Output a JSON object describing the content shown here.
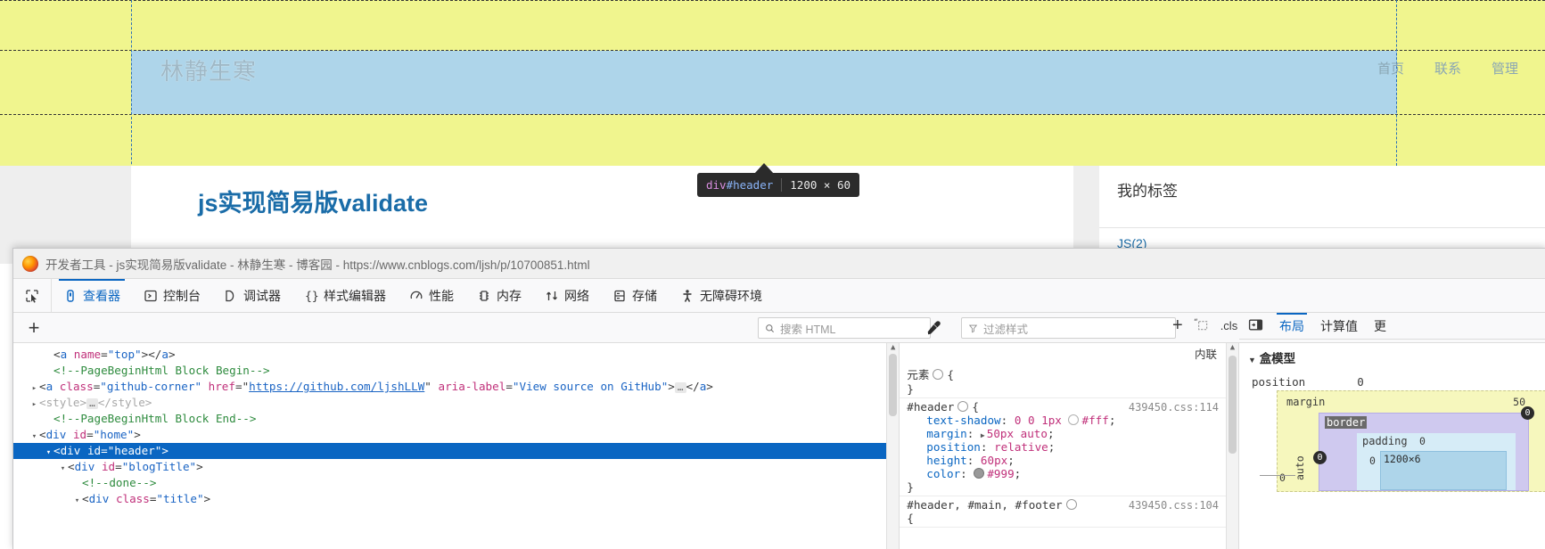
{
  "page": {
    "site_title": "林静生寒",
    "nav": [
      "首页",
      "联系",
      "管理"
    ],
    "post_title": "js实现简易版validate",
    "sidebar_card_title": "我的标签",
    "sidebar_tag": "JS(2)"
  },
  "tooltip": {
    "tag": "div",
    "id": "#header",
    "dimensions": "1200 × 60"
  },
  "devtools": {
    "window_title": "开发者工具 - js实现简易版validate - 林静生寒 - 博客园 - https://www.cnblogs.com/ljsh/p/10700851.html",
    "tabs": [
      {
        "label": "查看器",
        "icon": "inspector-icon",
        "active": true
      },
      {
        "label": "控制台",
        "icon": "console-icon",
        "active": false
      },
      {
        "label": "调试器",
        "icon": "debugger-icon",
        "active": false
      },
      {
        "label": "样式编辑器",
        "icon": "style-editor-icon",
        "active": false
      },
      {
        "label": "性能",
        "icon": "performance-icon",
        "active": false
      },
      {
        "label": "内存",
        "icon": "memory-icon",
        "active": false
      },
      {
        "label": "网络",
        "icon": "network-icon",
        "active": false
      },
      {
        "label": "存储",
        "icon": "storage-icon",
        "active": false
      },
      {
        "label": "无障碍环境",
        "icon": "accessibility-icon",
        "active": false
      }
    ],
    "html_search_placeholder": "搜索 HTML",
    "style_filter_placeholder": "过滤样式",
    "cls_label": ".cls",
    "add_rule_label": "+",
    "dom_add_label": "+"
  },
  "dom_tree": [
    {
      "indent": 1,
      "twisty": "",
      "type": "element",
      "parts": [
        {
          "t": "punct",
          "v": "<"
        },
        {
          "t": "tag",
          "v": "a"
        },
        {
          "t": "sp",
          "v": " "
        },
        {
          "t": "attr",
          "v": "name"
        },
        {
          "t": "punct",
          "v": "="
        },
        {
          "t": "val",
          "v": "\"top\""
        },
        {
          "t": "punct",
          "v": "></"
        },
        {
          "t": "tag",
          "v": "a"
        },
        {
          "t": "punct",
          "v": ">"
        }
      ]
    },
    {
      "indent": 1,
      "twisty": "",
      "type": "comment",
      "parts": [
        {
          "t": "comment",
          "v": "<!--PageBeginHtml Block Begin-->"
        }
      ]
    },
    {
      "indent": 0,
      "twisty": "▸",
      "type": "element",
      "parts": [
        {
          "t": "punct",
          "v": "<"
        },
        {
          "t": "tag",
          "v": "a"
        },
        {
          "t": "sp",
          "v": " "
        },
        {
          "t": "attr",
          "v": "class"
        },
        {
          "t": "punct",
          "v": "="
        },
        {
          "t": "val",
          "v": "\"github-corner\""
        },
        {
          "t": "sp",
          "v": " "
        },
        {
          "t": "attr",
          "v": "href"
        },
        {
          "t": "punct",
          "v": "="
        },
        {
          "t": "punct",
          "v": "\""
        },
        {
          "t": "link",
          "v": "https://github.com/ljshLLW"
        },
        {
          "t": "punct",
          "v": "\""
        },
        {
          "t": "sp",
          "v": " "
        },
        {
          "t": "attr",
          "v": "aria-label"
        },
        {
          "t": "punct",
          "v": "="
        },
        {
          "t": "val",
          "v": "\"View source on GitHub\""
        },
        {
          "t": "punct",
          "v": ">"
        },
        {
          "t": "badge",
          "v": "…"
        },
        {
          "t": "punct",
          "v": "</"
        },
        {
          "t": "tag",
          "v": "a"
        },
        {
          "t": "punct",
          "v": ">"
        }
      ]
    },
    {
      "indent": 0,
      "twisty": "▸",
      "type": "element-dim",
      "parts": [
        {
          "t": "dim",
          "v": "<style>"
        },
        {
          "t": "badge",
          "v": "…"
        },
        {
          "t": "dim",
          "v": "</style>"
        }
      ]
    },
    {
      "indent": 1,
      "twisty": "",
      "type": "comment",
      "parts": [
        {
          "t": "comment",
          "v": "<!--PageBeginHtml Block End-->"
        }
      ]
    },
    {
      "indent": 0,
      "twisty": "▾",
      "type": "element",
      "parts": [
        {
          "t": "punct",
          "v": "<"
        },
        {
          "t": "tag",
          "v": "div"
        },
        {
          "t": "sp",
          "v": " "
        },
        {
          "t": "attr",
          "v": "id"
        },
        {
          "t": "punct",
          "v": "="
        },
        {
          "t": "val",
          "v": "\"home\""
        },
        {
          "t": "punct",
          "v": ">"
        }
      ]
    },
    {
      "indent": 1,
      "twisty": "▾",
      "type": "element",
      "selected": true,
      "parts": [
        {
          "t": "punct",
          "v": "<"
        },
        {
          "t": "tag",
          "v": "div"
        },
        {
          "t": "sp",
          "v": " "
        },
        {
          "t": "attr",
          "v": "id"
        },
        {
          "t": "punct",
          "v": "="
        },
        {
          "t": "val",
          "v": "\"header\""
        },
        {
          "t": "punct",
          "v": ">"
        }
      ]
    },
    {
      "indent": 2,
      "twisty": "▾",
      "type": "element",
      "parts": [
        {
          "t": "punct",
          "v": "<"
        },
        {
          "t": "tag",
          "v": "div"
        },
        {
          "t": "sp",
          "v": " "
        },
        {
          "t": "attr",
          "v": "id"
        },
        {
          "t": "punct",
          "v": "="
        },
        {
          "t": "val",
          "v": "\"blogTitle\""
        },
        {
          "t": "punct",
          "v": ">"
        }
      ]
    },
    {
      "indent": 3,
      "twisty": "",
      "type": "comment",
      "parts": [
        {
          "t": "comment",
          "v": "<!--done-->"
        }
      ]
    },
    {
      "indent": 3,
      "twisty": "▾",
      "type": "element",
      "parts": [
        {
          "t": "punct",
          "v": "<"
        },
        {
          "t": "tag",
          "v": "div"
        },
        {
          "t": "sp",
          "v": " "
        },
        {
          "t": "attr",
          "v": "class"
        },
        {
          "t": "punct",
          "v": "="
        },
        {
          "t": "val",
          "v": "\"title\""
        },
        {
          "t": "punct",
          "v": ">"
        }
      ]
    }
  ],
  "css_rules": {
    "inline_label": "内联",
    "rules": [
      {
        "selector": "元素",
        "source": "",
        "declarations": []
      },
      {
        "selector": "#header",
        "source": "439450.css:114",
        "declarations": [
          {
            "prop": "text-shadow",
            "value": "0 0 1px",
            "swatch": "ring",
            "value2": "#fff"
          },
          {
            "prop": "margin",
            "value": "50px auto",
            "triangle": true
          },
          {
            "prop": "position",
            "value": "relative"
          },
          {
            "prop": "height",
            "value": "60px"
          },
          {
            "prop": "color",
            "value": "",
            "swatch": "gray",
            "value2": "#999"
          }
        ]
      },
      {
        "selector": "#header, #main, #footer",
        "source": "439450.css:104",
        "declarations": []
      }
    ]
  },
  "layout_panel": {
    "tabs": [
      "布局",
      "计算值",
      "更"
    ],
    "active_tab": "布局",
    "section_title": "盒模型",
    "position_label": "position",
    "position_value": "0",
    "margin_label": "margin",
    "margin_top": "50",
    "margin_right": "0",
    "margin_left_auto": "auto",
    "border_label": "border",
    "border_value": "0",
    "padding_label": "padding",
    "padding_value": "0",
    "content_size": "1200×6",
    "left_zero": "0",
    "inner_zero": "0"
  }
}
